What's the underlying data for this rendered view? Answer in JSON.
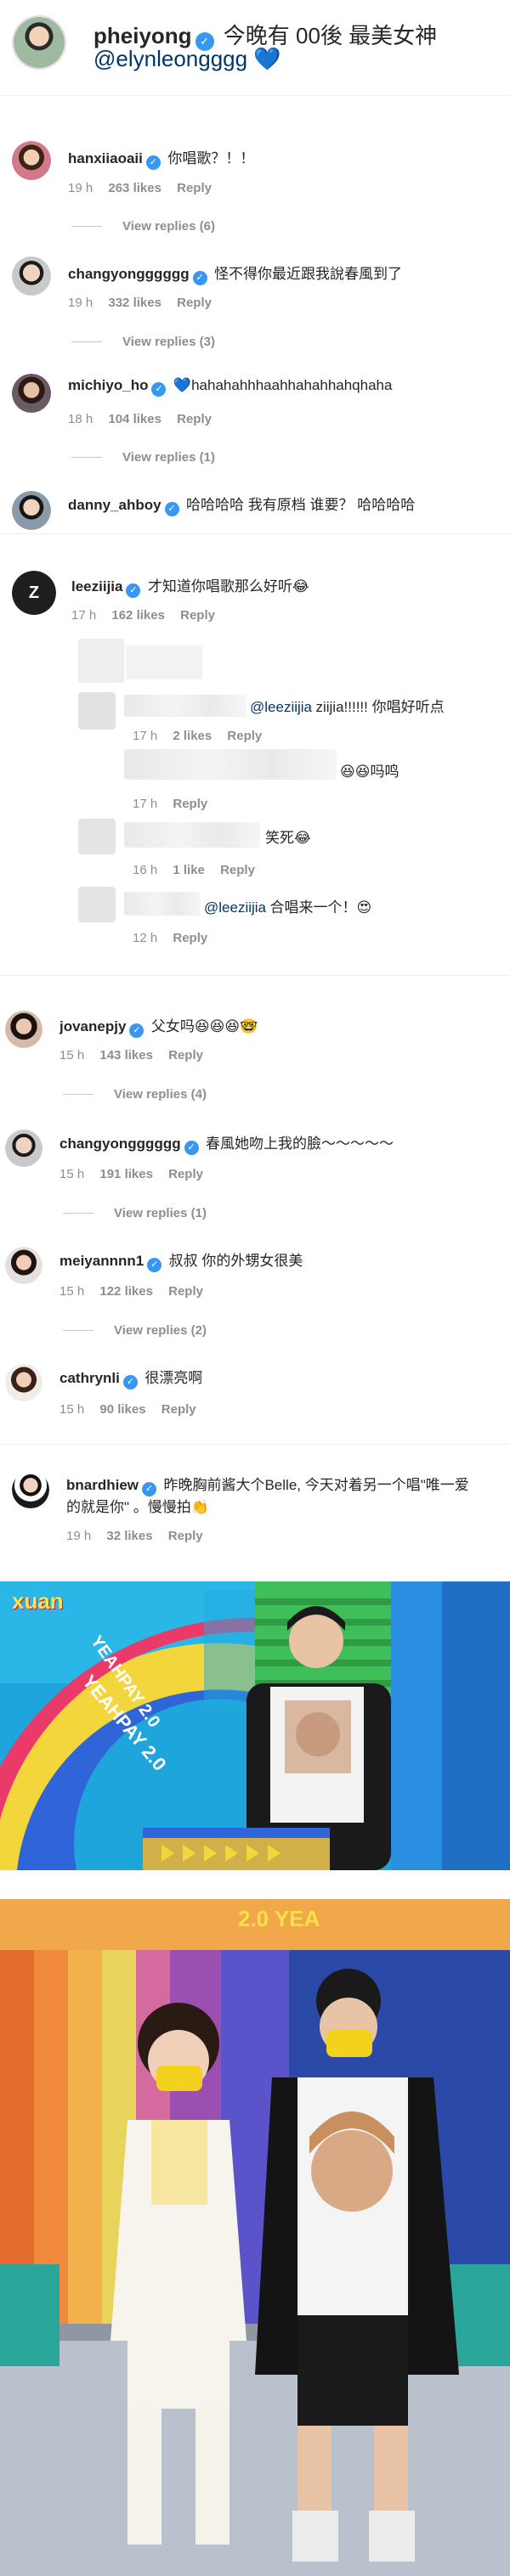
{
  "post": {
    "username": "pheiyong",
    "caption": "今晚有 00後 最美女神",
    "mention": "@elynleongggg",
    "heart": "💙"
  },
  "comments": [
    {
      "id": "c1",
      "username": "hanxiiaoaii",
      "verified": true,
      "text": "你唱歌？！！",
      "time": "19 h",
      "likes": "263 likes",
      "reply": "Reply",
      "view_replies": "View replies (6)"
    },
    {
      "id": "c2",
      "username": "changyongggggg",
      "verified": true,
      "text": "怪不得你最近跟我說春風到了",
      "time": "19 h",
      "likes": "332 likes",
      "reply": "Reply",
      "view_replies": "View replies (3)"
    },
    {
      "id": "c3",
      "username": "michiyo_ho",
      "verified": true,
      "text": "💙hahahahhhaahhahahhahqhaha",
      "time": "18 h",
      "likes": "104 likes",
      "reply": "Reply",
      "view_replies": "View replies (1)"
    },
    {
      "id": "c4",
      "username": "danny_ahboy",
      "verified": true,
      "text": "哈哈哈哈 我有原档 谁要？ 哈哈哈哈"
    },
    {
      "id": "c5",
      "username": "leeziijia",
      "verified": true,
      "text": "才知道你唱歌那么好听😂",
      "time": "17 h",
      "likes": "162 likes",
      "reply": "Reply"
    },
    {
      "id": "c6",
      "username": "jovanepjy",
      "verified": true,
      "text": "父女吗😆😆😆🤓",
      "time": "15 h",
      "likes": "143 likes",
      "reply": "Reply",
      "view_replies": "View replies (4)"
    },
    {
      "id": "c7",
      "username": "changyongggggg",
      "verified": true,
      "text": "春風她吻上我的臉～～～～～",
      "time": "15 h",
      "likes": "191 likes",
      "reply": "Reply",
      "view_replies": "View replies (1)"
    },
    {
      "id": "c8",
      "username": "meiyannnn1",
      "verified": true,
      "text": "叔叔 你的外甥女很美",
      "time": "15 h",
      "likes": "122 likes",
      "reply": "Reply",
      "view_replies": "View replies (2)"
    },
    {
      "id": "c9",
      "username": "cathrynli",
      "verified": true,
      "text": "很漂亮啊",
      "time": "15 h",
      "likes": "90 likes",
      "reply": "Reply"
    },
    {
      "id": "c10",
      "username": "bnardhiew",
      "verified": true,
      "text_line1": "昨晚胸前酱大个Belle, 今天对着另一个唱\"唯一爱",
      "text_line2": "的就是你\" 。慢慢拍👏",
      "time": "19 h",
      "likes": "32 likes",
      "reply": "Reply"
    }
  ],
  "replies": [
    {
      "id": "r1",
      "mention": "@leeziijia",
      "text": "ziijia!!!!!! 你唱好听点",
      "time": "17 h",
      "likes": "2 likes",
      "reply": "Reply"
    },
    {
      "id": "r2",
      "text": "😆😆吗鸣",
      "time": "17 h",
      "reply": "Reply"
    },
    {
      "id": "r3",
      "text": "笑死😂",
      "time": "16 h",
      "likes": "1 like",
      "reply": "Reply"
    },
    {
      "id": "r4",
      "mention": "@leeziijia",
      "text": "合唱来一个！😍",
      "time": "12 h",
      "reply": "Reply"
    }
  ],
  "photos": {
    "photo1": {
      "logo": "xuan",
      "banner_text": "YEAHPAY 2.0"
    },
    "photo2": {
      "banner_text": "2.0 YEA"
    }
  },
  "colors": {
    "verified": "#3897f0",
    "muted": "#8e8e8e",
    "mention": "#00376b",
    "accent_heart": "#1a73e8"
  }
}
